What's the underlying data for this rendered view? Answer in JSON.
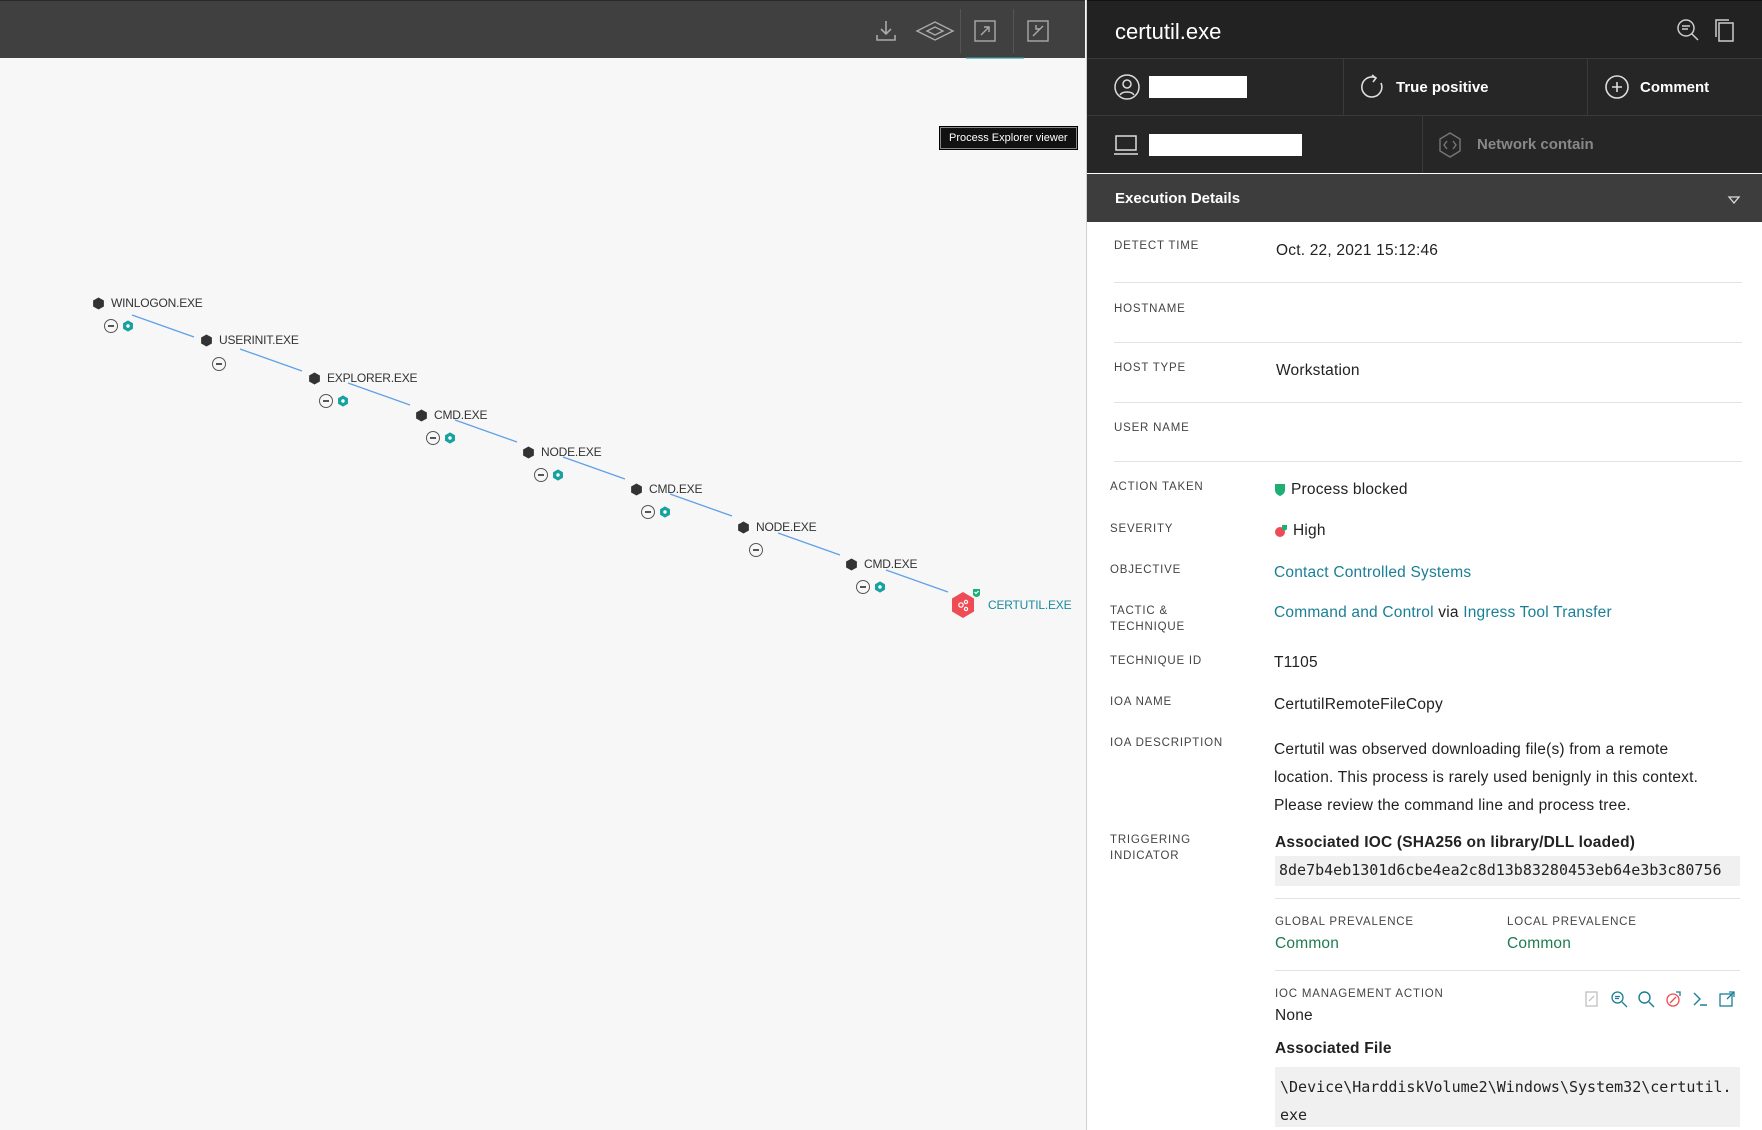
{
  "toolbar": {
    "icons": [
      "download-icon",
      "layers-icon",
      "expand-icon",
      "collapse-icon"
    ],
    "tooltip": "Process Explorer viewer"
  },
  "graph": {
    "nodes": [
      {
        "label": "WINLOGON.EXE"
      },
      {
        "label": "USERINIT.EXE"
      },
      {
        "label": "EXPLORER.EXE"
      },
      {
        "label": "CMD.EXE"
      },
      {
        "label": "NODE.EXE"
      },
      {
        "label": "CMD.EXE"
      },
      {
        "label": "NODE.EXE"
      },
      {
        "label": "CMD.EXE"
      },
      {
        "label": "CERTUTIL.EXE"
      }
    ]
  },
  "panel": {
    "title": "certutil.exe",
    "actions": {
      "true_positive": "True positive",
      "comment": "Comment",
      "network_contain": "Network contain"
    },
    "section_title": "Execution Details",
    "fields": {
      "detect_time_label": "DETECT TIME",
      "detect_time": "Oct. 22, 2021 15:12:46",
      "hostname_label": "HOSTNAME",
      "host_type_label": "HOST TYPE",
      "host_type": "Workstation",
      "user_name_label": "USER NAME",
      "action_taken_label": "ACTION TAKEN",
      "action_taken": "Process blocked",
      "severity_label": "SEVERITY",
      "severity": "High",
      "objective_label": "OBJECTIVE",
      "objective": "Contact Controlled Systems",
      "tactic_label_1": "TACTIC &",
      "tactic_label_2": "TECHNIQUE",
      "tactic": "Command and Control",
      "tactic_via": "via",
      "technique": "Ingress Tool Transfer",
      "technique_id_label": "TECHNIQUE ID",
      "technique_id": "T1105",
      "ioa_name_label": "IOA NAME",
      "ioa_name": "CertutilRemoteFileCopy",
      "ioa_desc_label": "IOA DESCRIPTION",
      "ioa_desc_1": "Certutil was observed downloading file(s) from a remote",
      "ioa_desc_2": "location. This process is rarely used benignly in this context.",
      "ioa_desc_3": "Please review the command line and process tree.",
      "triggering_label_1": "TRIGGERING",
      "triggering_label_2": "INDICATOR",
      "assoc_ioc_title": "Associated IOC (SHA256 on library/DLL loaded)",
      "assoc_ioc_hash": "8de7b4eb1301d6cbe4ea2c8d13b83280453eb64e3b3c80756",
      "global_prev_label": "GLOBAL PREVALENCE",
      "global_prev": "Common",
      "local_prev_label": "LOCAL PREVALENCE",
      "local_prev": "Common",
      "ioc_mgmt_label": "IOC MANAGEMENT ACTION",
      "ioc_mgmt": "None",
      "assoc_file_title": "Associated File",
      "assoc_file_path": "\\Device\\HarddiskVolume2\\Windows\\System32\\certutil.exe"
    }
  },
  "colors": {
    "accent": "#1a7f96",
    "danger": "#ef4b55",
    "teal": "#17a2a0",
    "green_text": "#1f7a52"
  }
}
